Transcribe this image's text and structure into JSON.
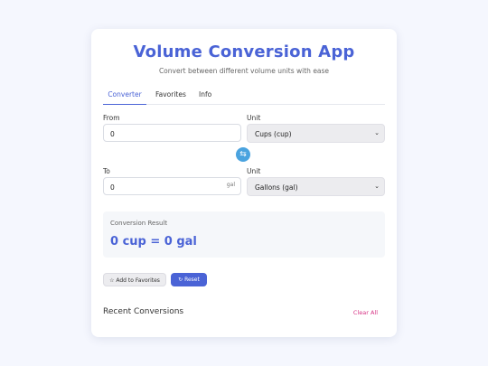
{
  "app": {
    "title": "Volume Conversion App",
    "subtitle": "Convert between different volume units with ease"
  },
  "tabs": [
    {
      "label": "Converter",
      "active": true
    },
    {
      "label": "Favorites",
      "active": false
    },
    {
      "label": "Info",
      "active": false
    }
  ],
  "from": {
    "label": "From",
    "value": "0",
    "unit_label": "Unit",
    "unit_selected": "Cups (cup)"
  },
  "to": {
    "label": "To",
    "value": "0",
    "suffix": "gal",
    "unit_label": "Unit",
    "unit_selected": "Gallons (gal)"
  },
  "result": {
    "label": "Conversion Result",
    "value": "0 cup = 0 gal"
  },
  "actions": {
    "favorite_label": "Add to Favorites",
    "reset_label": "Reset"
  },
  "recent": {
    "title": "Recent Conversions",
    "clear_label": "Clear All"
  },
  "colors": {
    "accent": "#4a63d6",
    "swap": "#4aa3df",
    "danger": "#d63384",
    "background": "#f5f7fe"
  },
  "icons": {
    "swap": "swap-arrows-icon",
    "favorite": "star-outline-icon",
    "reset": "refresh-icon",
    "dropdown": "chevron-down-icon"
  }
}
